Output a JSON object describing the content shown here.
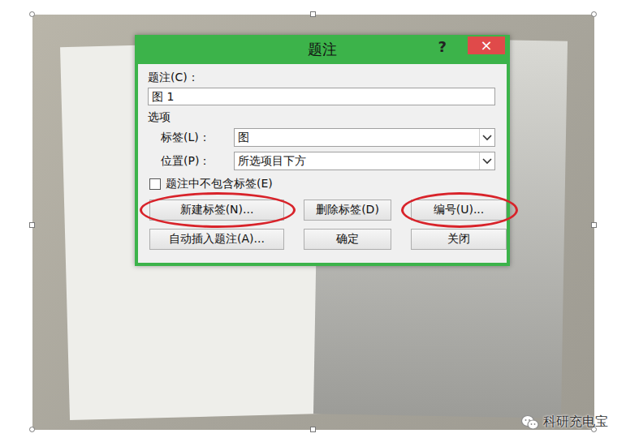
{
  "dialog": {
    "title": "题注",
    "help": "?",
    "close": "×"
  },
  "caption": {
    "label": "题注(C)：",
    "value": "图 1"
  },
  "options_heading": "选项",
  "fields": [
    {
      "label": "标签(L)：",
      "value": "图"
    },
    {
      "label": "位置(P)：",
      "value": "所选项目下方"
    }
  ],
  "checkbox": {
    "label": "题注中不包含标签(E)",
    "checked": false
  },
  "button_rows": [
    [
      {
        "label": "新建标签(N)...",
        "circled": true
      },
      {
        "label": "删除标签(D)",
        "circled": false
      },
      {
        "label": "编号(U)...",
        "circled": true
      }
    ],
    [
      {
        "label": "自动插入题注(A)...",
        "circled": false
      },
      {
        "label": "确定",
        "circled": false
      },
      {
        "label": "关闭",
        "circled": false
      }
    ]
  ],
  "watermark": "科研充电宝"
}
